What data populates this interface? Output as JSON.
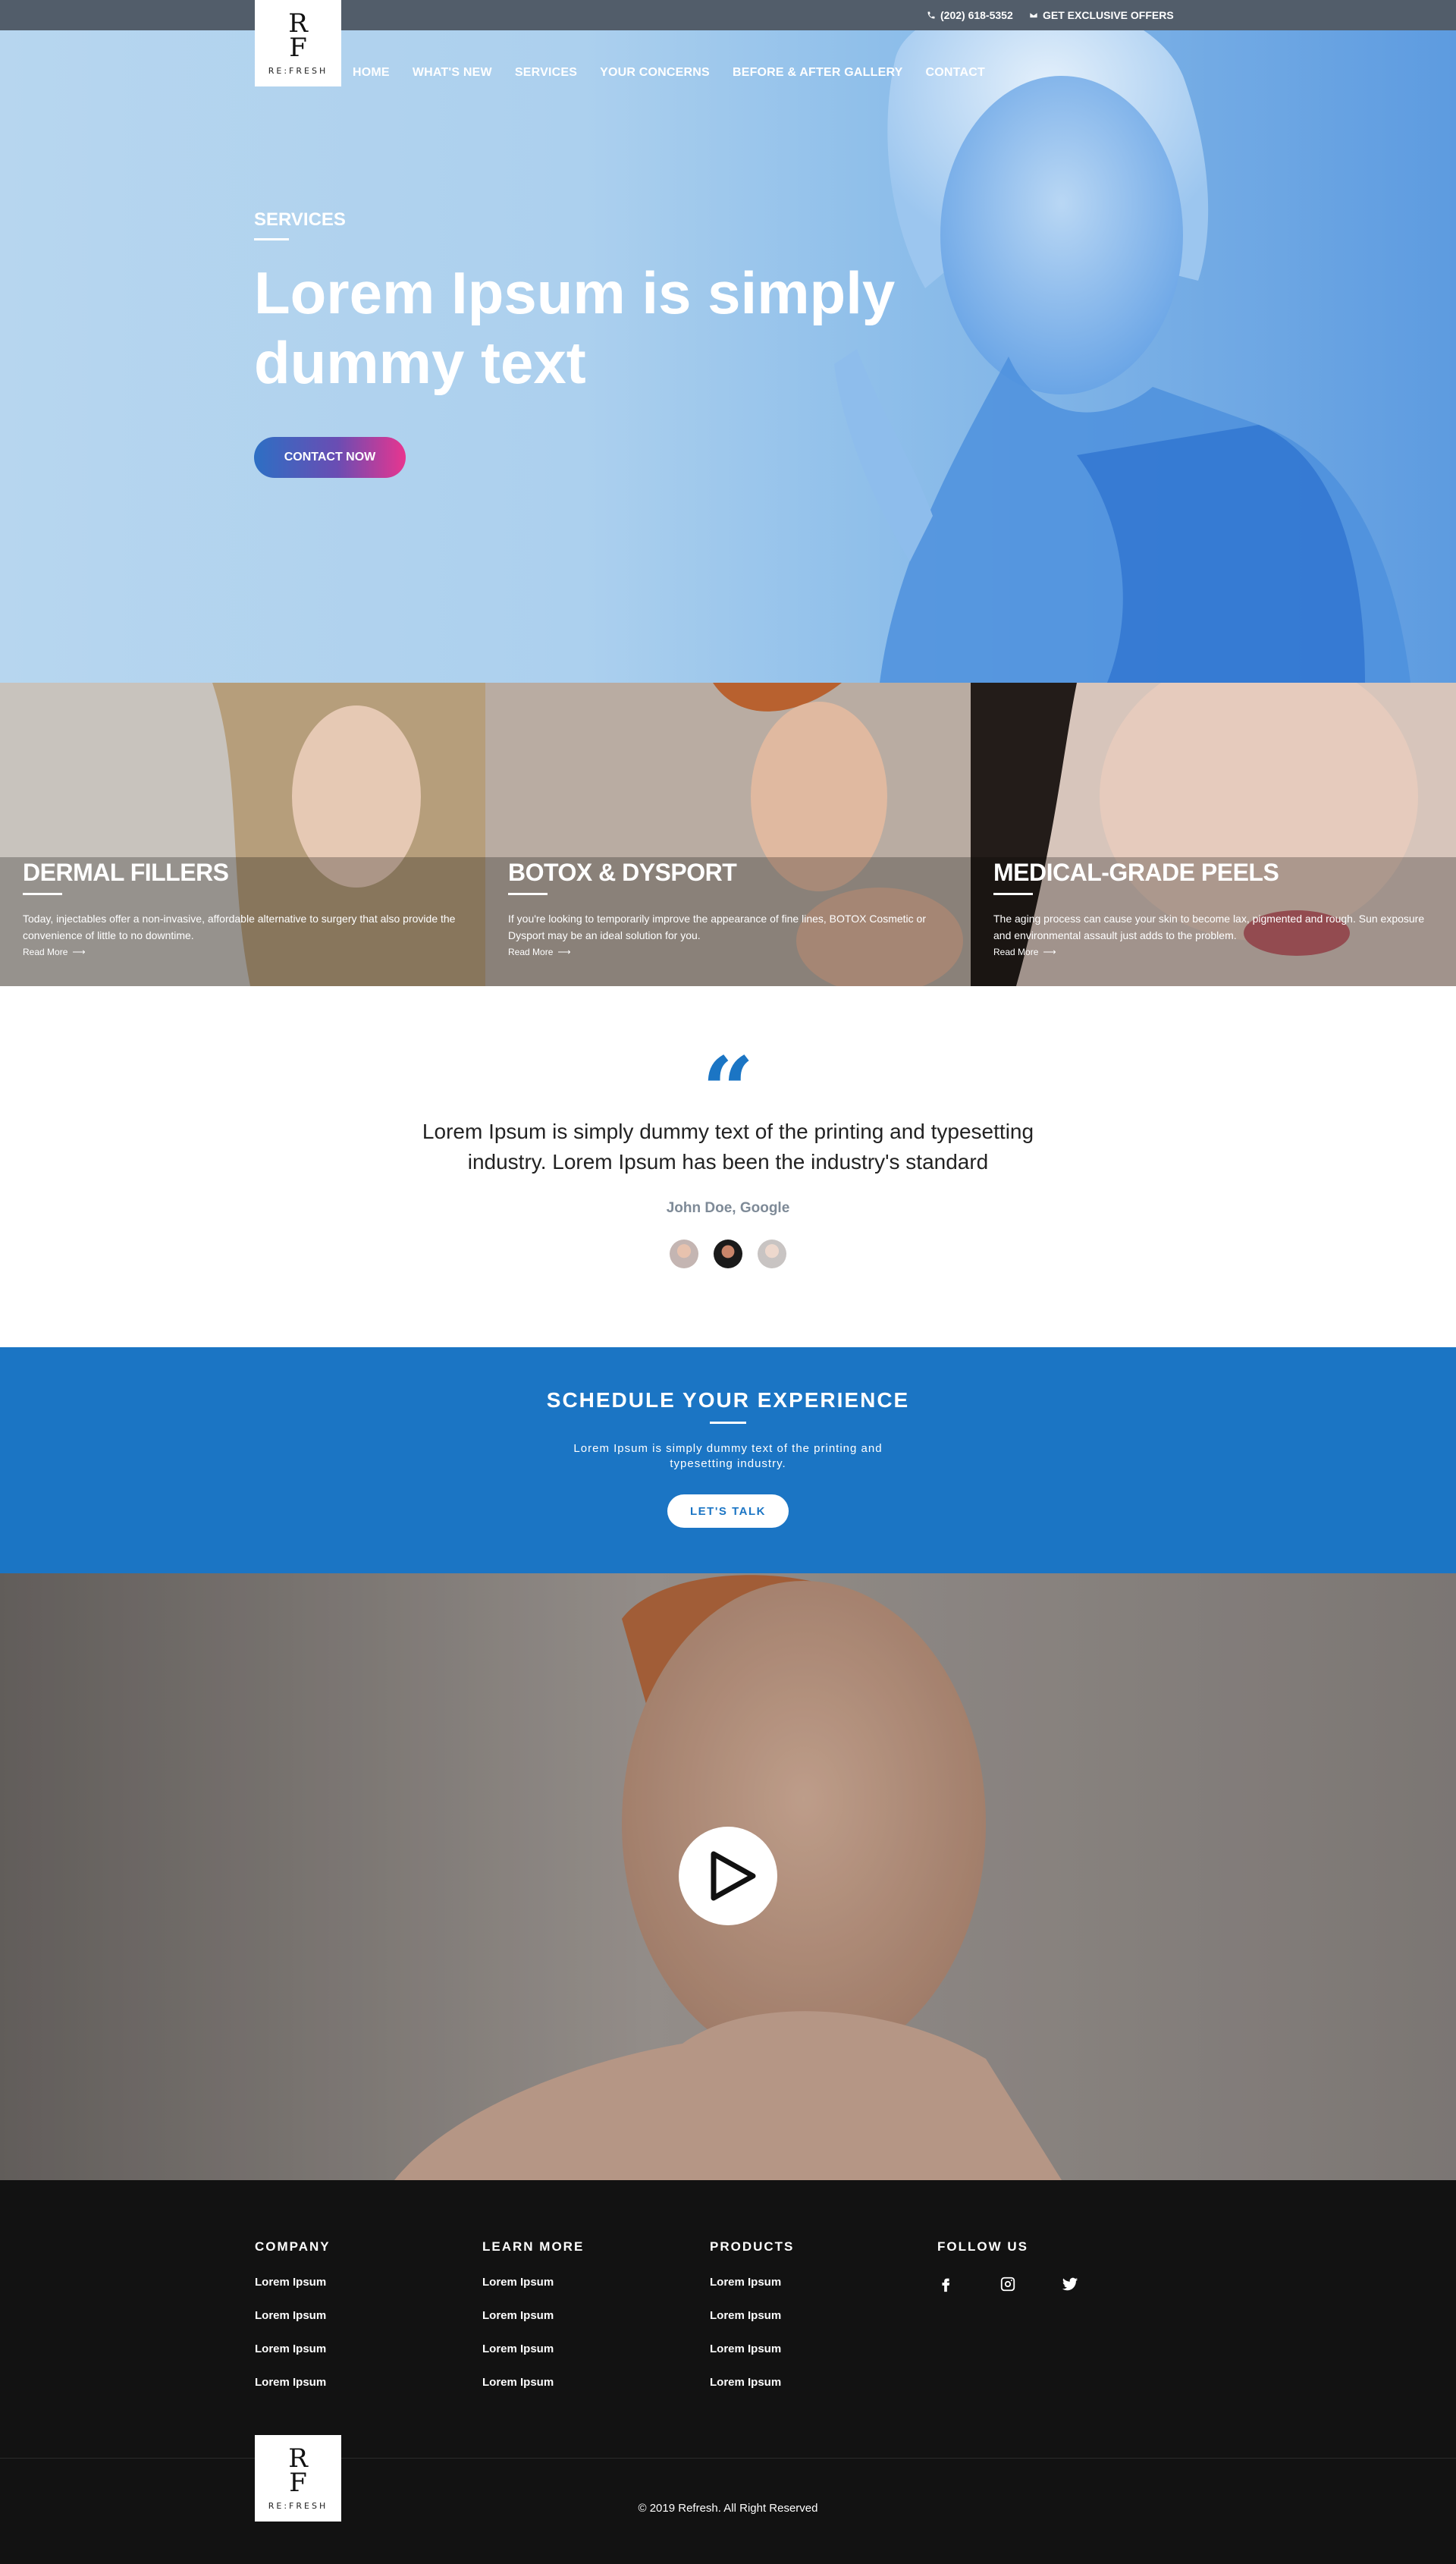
{
  "topbar": {
    "phone": "(202) 618-5352",
    "offers": "GET EXCLUSIVE OFFERS"
  },
  "brand": {
    "monogram_top": "R",
    "monogram_bottom": "F",
    "wordmark": "RE:FRESH"
  },
  "nav": {
    "items": [
      "HOME",
      "WHAT'S NEW",
      "SERVICES",
      "YOUR CONCERNS",
      "BEFORE & AFTER GALLERY",
      "CONTACT"
    ]
  },
  "hero": {
    "eyebrow": "SERVICES",
    "headline": "Lorem Ipsum is simply dummy text",
    "cta": "CONTACT NOW"
  },
  "services": [
    {
      "title": "DERMAL FILLERS",
      "text": "Today, injectables offer a non-invasive, affordable alternative to surgery that also provide the convenience of little to no downtime.",
      "link": "Read More"
    },
    {
      "title": "BOTOX & DYSPORT",
      "text": "If you're looking to temporarily improve the appearance of fine lines, BOTOX Cosmetic or Dysport may be an ideal solution for you.",
      "link": "Read More"
    },
    {
      "title": "MEDICAL-GRADE PEELS",
      "text": "The aging process can cause your skin to become lax, pigmented and rough. Sun exposure and environmental assault just adds to the problem.",
      "link": "Read More"
    }
  ],
  "testimonial": {
    "quote_mark": "“",
    "text": "Lorem Ipsum is simply dummy text of the printing and typesetting industry. Lorem Ipsum has been the industry's standard",
    "author": "John Doe, Google"
  },
  "schedule": {
    "title": "SCHEDULE YOUR EXPERIENCE",
    "text": "Lorem Ipsum is simply dummy text of the printing and typesetting industry.",
    "button": "LET'S TALK"
  },
  "footer": {
    "columns": [
      {
        "title": "COMPANY",
        "links": [
          "Lorem Ipsum",
          "Lorem Ipsum",
          "Lorem Ipsum",
          "Lorem Ipsum"
        ]
      },
      {
        "title": "LEARN MORE",
        "links": [
          "Lorem Ipsum",
          "Lorem Ipsum",
          "Lorem Ipsum",
          "Lorem Ipsum"
        ]
      },
      {
        "title": "PRODUCTS",
        "links": [
          "Lorem Ipsum",
          "Lorem Ipsum",
          "Lorem Ipsum",
          "Lorem Ipsum"
        ]
      }
    ],
    "follow_title": "FOLLOW US",
    "social_icons": [
      "facebook-icon",
      "instagram-icon",
      "twitter-icon"
    ],
    "copyright": "© 2019 Refresh. All Right Reserved"
  },
  "colors": {
    "brand_blue": "#1b75c4",
    "topbar": "#525d6a",
    "footer": "#121212",
    "cta_gradient_start": "#2d6fc4",
    "cta_gradient_end": "#e8358f"
  }
}
